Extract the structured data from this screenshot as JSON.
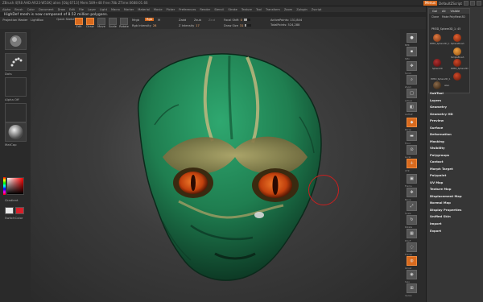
{
  "titlebar": {
    "title": "ZBrush 4[R8 AHD-AR23-W53K] alien [Obj:6713] Mem:589+48 Free:78b ZTime:0688:01.66",
    "menus_button": "Menus",
    "script_label": "DefaultZScript"
  },
  "menubar": {
    "items": [
      "Alpha",
      "Brush",
      "Color",
      "Document",
      "Draw",
      "Edit",
      "File",
      "Layer",
      "Light",
      "Macro",
      "Marker",
      "Material",
      "Movie",
      "Picker",
      "Preferences",
      "Render",
      "Stencil",
      "Stroke",
      "Texture",
      "Tool",
      "Transform",
      "Zoom",
      "Zplugin",
      "Zscript"
    ]
  },
  "notice": "HighDef mesh is now composed of 8.52 million polygons.",
  "toolshelf": {
    "projection_master": "Projection Master",
    "lightbox": "LightBox",
    "quick_sketch": "Quick Sketch",
    "edit": "Edit",
    "draw": "Draw",
    "move": "Move",
    "scale": "Scale",
    "rotate": "Rotate",
    "mrgb": "Mrgb",
    "rgb": "Rgb",
    "m": "M",
    "zadd": "Zadd",
    "zsub": "Zsub",
    "zcut": "Zcut",
    "rgb_intensity_label": "Rgb Intensity",
    "rgb_intensity_value": "28",
    "z_intensity_label": "Z Intensity",
    "z_intensity_value": "17",
    "focal_shift_label": "Focal Shift",
    "focal_shift_value": "0",
    "draw_size_label": "Draw Size",
    "draw_size_value": "31",
    "active_points": "ActivePoints: 131,844",
    "total_points": "TotalPoints: 524,288"
  },
  "leftshelf": {
    "gradient": "Gradient",
    "switch_color": "SwitchColor",
    "stroke_label": "Dots",
    "alpha_label": "Alpha Off",
    "texture_label": "Texture Off",
    "material_label": "MatCap"
  },
  "rightshelf": {
    "buttons": [
      "BPR",
      "SPix",
      "Scroll",
      "Zoom",
      "Actual",
      "AAHalf",
      "Persp",
      "Floor",
      "Local",
      "XYZ",
      "Frame",
      "Move",
      "Scale",
      "Rotate",
      "PolyF",
      "Transp",
      "Ghost",
      "Solo",
      "Xpose"
    ]
  },
  "tray": {
    "tabs": [
      "Gol",
      "All",
      "Visible"
    ],
    "tools": [
      "Clone",
      "Make PolyMesh3D"
    ],
    "current_tool": "PM3D_Sphere3D_1: 45",
    "thumbs": [
      "PM3D_Sphere3D_1",
      "SphereBrush",
      "SimpleBrush",
      "Sphere3D",
      "PM3D_Sphere3D",
      "PM3D_Sphere3D_1",
      "alien"
    ],
    "menu_items": [
      "SubTool",
      "Layers",
      "Geometry",
      "Geometry HD",
      "Preview",
      "Surface",
      "Deformation",
      "Masking",
      "Visibility",
      "Polygroups",
      "Contact",
      "Morph Target",
      "Polypaint",
      "UV Map",
      "Texture Map",
      "Displacement Map",
      "Normal Map",
      "Display Properties",
      "Unified Skin",
      "Import",
      "Export"
    ]
  },
  "colors": {
    "accent": "#d86a1e",
    "brush_ring": "#c82020",
    "skin_green": "#1f8a5a",
    "eye_red": "#d04a10"
  }
}
